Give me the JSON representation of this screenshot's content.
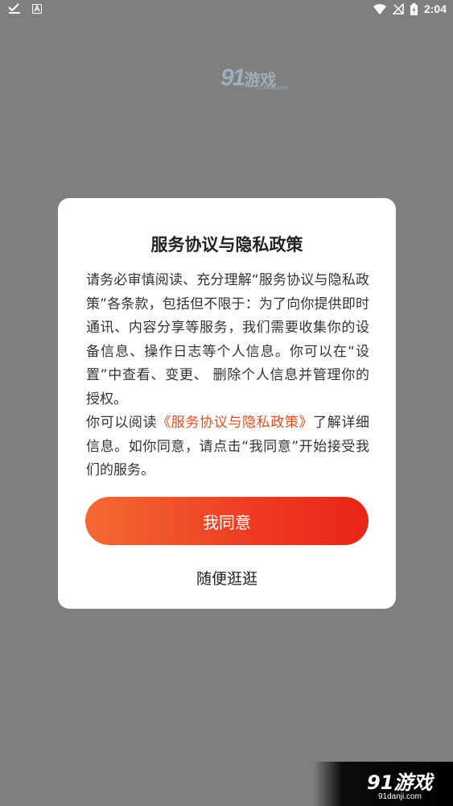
{
  "status_bar": {
    "time": "2:04"
  },
  "background": {
    "logo_number": "91",
    "logo_text": "游戏",
    "logo_sub": "91danji.com"
  },
  "dialog": {
    "title": "服务协议与隐私政策",
    "paragraph1": "请务必审慎阅读、充分理解“服务协议与隐私政策”各条款，包括但不限于：为了向你提供即时通讯、内容分享等服务，我们需要收集你的设备信息、操作日志等个人信息。你可以在“设置”中查看、变更、 删除个人信息并管理你的授权。",
    "paragraph2_before": "你可以阅读",
    "paragraph2_link": "《服务协议与隐私政策》",
    "paragraph2_after": "了解详细信息。如你同意，请点击“我同意”开始接受我们的服务。",
    "agree_label": "我同意",
    "browse_label": "随便逛逛"
  },
  "watermark": {
    "logo": "91游戏",
    "sub": "91danji.com"
  }
}
